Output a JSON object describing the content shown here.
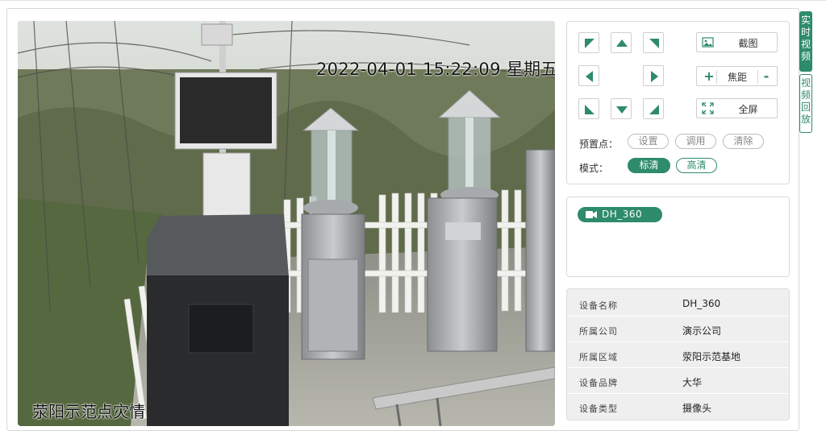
{
  "video": {
    "timestamp": "2022-04-01 15:22:09 星期五",
    "caption": "荥阳示范点灾情"
  },
  "ptz": {
    "buttons": [
      "up-left",
      "up",
      "up-right",
      "left",
      "right",
      "down-left",
      "down",
      "down-right"
    ]
  },
  "tools": {
    "screenshot_label": "截图",
    "focus_label": "焦距",
    "focus_plus": "+",
    "focus_minus": "-",
    "fullscreen_label": "全屏"
  },
  "preset": {
    "label": "预置点：",
    "set": "设置",
    "call": "调用",
    "clear": "清除"
  },
  "mode": {
    "label": "模式：",
    "sd": "标清",
    "hd": "高清",
    "selected": "标清"
  },
  "camera_list": [
    {
      "name": "DH_360"
    }
  ],
  "device_info": [
    {
      "key": "设备名称",
      "value": "DH_360"
    },
    {
      "key": "所属公司",
      "value": "演示公司"
    },
    {
      "key": "所属区域",
      "value": "荥阳示范基地"
    },
    {
      "key": "设备品牌",
      "value": "大华"
    },
    {
      "key": "设备类型",
      "value": "摄像头"
    }
  ],
  "side_tabs": {
    "live": "实时视频",
    "playback": "视频回放"
  },
  "colors": {
    "accent": "#2e8b6b"
  }
}
